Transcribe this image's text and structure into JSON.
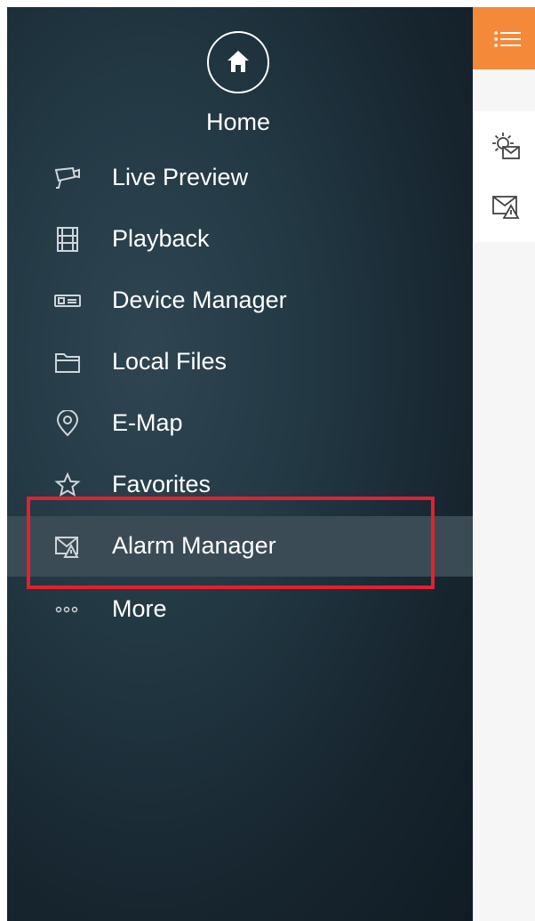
{
  "home": {
    "label": "Home",
    "icon": "home-icon"
  },
  "menu": [
    {
      "label": "Live Preview",
      "icon": "camera-icon"
    },
    {
      "label": "Playback",
      "icon": "film-icon"
    },
    {
      "label": "Device Manager",
      "icon": "device-icon"
    },
    {
      "label": "Local Files",
      "icon": "folder-icon"
    },
    {
      "label": "E-Map",
      "icon": "map-pin-icon"
    },
    {
      "label": "Favorites",
      "icon": "star-icon"
    },
    {
      "label": "Alarm Manager",
      "icon": "alarm-mail-icon",
      "active": true
    },
    {
      "label": "More",
      "icon": "more-dots-icon"
    }
  ],
  "colors": {
    "accent": "#f5893a",
    "highlight": "#e3202f",
    "drawer": "#1b2a33",
    "active_row": "#3a4b55"
  },
  "right_pane": {
    "icons": [
      "settings-mail-icon",
      "alarm-mail-icon"
    ]
  }
}
